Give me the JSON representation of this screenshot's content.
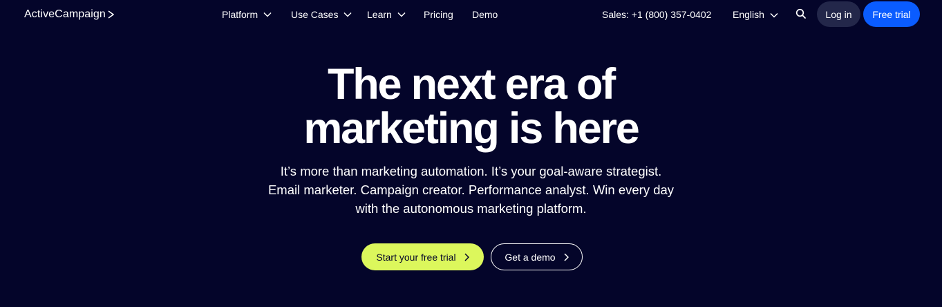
{
  "brand": {
    "name": "ActiveCampaign",
    "logo_icon": "chevron-right-icon"
  },
  "nav": {
    "items": [
      {
        "label": "Platform",
        "has_dropdown": true
      },
      {
        "label": "Use Cases",
        "has_dropdown": true
      },
      {
        "label": "Learn",
        "has_dropdown": true
      },
      {
        "label": "Pricing",
        "has_dropdown": false
      },
      {
        "label": "Demo",
        "has_dropdown": false
      }
    ],
    "sales": "Sales: +1 (800) 357-0402",
    "language": "English",
    "search_icon": "search-icon",
    "login_label": "Log in",
    "trial_label": "Free trial"
  },
  "hero": {
    "title_lines": [
      "The next era of",
      "marketing is here"
    ],
    "subtitle_lines": [
      "It’s more than marketing automation. It’s your goal-aware strategist.",
      "Email marketer. Campaign creator. Performance analyst. Win every day",
      "with the autonomous marketing platform."
    ],
    "cta_primary": "Start your free trial",
    "cta_secondary": "Get a demo"
  },
  "colors": {
    "background": "#04052a",
    "login_bg": "#23274a",
    "trial_bg": "#0a5cff",
    "cta_primary_bg": "#dcf75c",
    "text": "#ffffff"
  }
}
